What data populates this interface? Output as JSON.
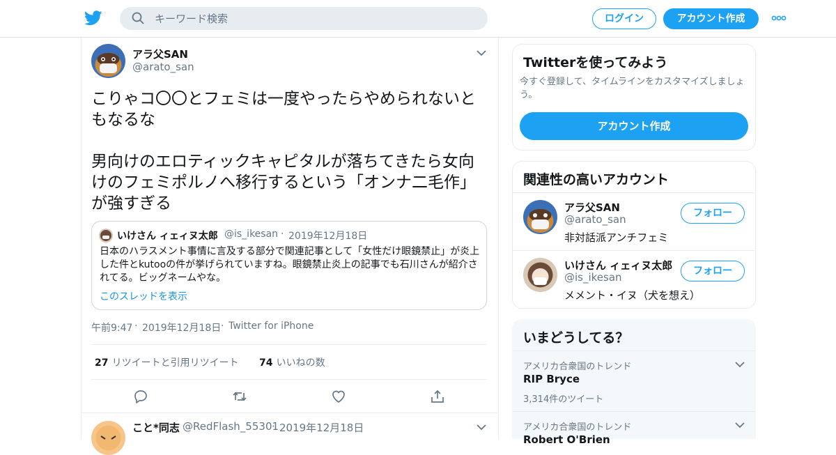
{
  "header": {
    "search_placeholder": "キーワード検索",
    "login_label": "ログイン",
    "signup_label": "アカウント作成"
  },
  "tweet": {
    "author_name": "アラ父SAN",
    "author_handle": "@arato_san",
    "text": "こりゃコ〇〇とフェミは一度やったらやめられないともなるな\n\n男向けのエロティックキャピタルが落ちてきたら女向けのフェミポルノへ移行するという「オンナ二毛作」が強すぎる",
    "quote": {
      "author_name": "いけさん ィェィヌ太郎",
      "author_handle": "@is_ikesan",
      "date": "2019年12月18日",
      "text": "日本のハラスメント事情に言及する部分で関連記事として「女性だけ眼鏡禁止」が炎上した件とkutooの件が挙げられていますね。眼鏡禁止炎上の記事でも石川さんが紹介されてる。ビッグネームやな。",
      "thread_link": "このスレッドを表示"
    },
    "time": "午前9:47",
    "date": "2019年12月18日",
    "source": "Twitter for iPhone",
    "retweet_count": "27",
    "retweet_label": "リツイートと引用リツイート",
    "like_count": "74",
    "like_label": "いいねの数"
  },
  "reply": {
    "author_name": "こと*同志",
    "author_handle": "@RedFlash_55301",
    "date": "2019年12月18日"
  },
  "signup_card": {
    "title": "Twitterを使ってみよう",
    "subtitle": "今すぐ登録して、タイムラインをカスタマイズしましょう。",
    "button_label": "アカウント作成"
  },
  "related": {
    "title": "関連性の高いアカウント",
    "follow_label": "フォロー",
    "accounts": [
      {
        "name": "アラ父SAN",
        "handle": "@arato_san",
        "bio": "非対話派アンチフェミ"
      },
      {
        "name": "いけさん ィェィヌ太郎",
        "handle": "@is_ikesan",
        "bio": "メメント・イヌ（犬を想え）"
      }
    ]
  },
  "trends": {
    "title": "いまどうしてる？",
    "items": [
      {
        "context": "アメリカ合衆国のトレンド",
        "name": "RIP Bryce",
        "count": "3,314件のツイート"
      },
      {
        "context": "アメリカ合衆国のトレンド",
        "name": "Robert O'Brien",
        "count": ""
      }
    ]
  },
  "colors": {
    "accent": "#1da1f2",
    "link": "#1b95e0",
    "muted_text": "#657786",
    "border": "#e6ecf0"
  }
}
